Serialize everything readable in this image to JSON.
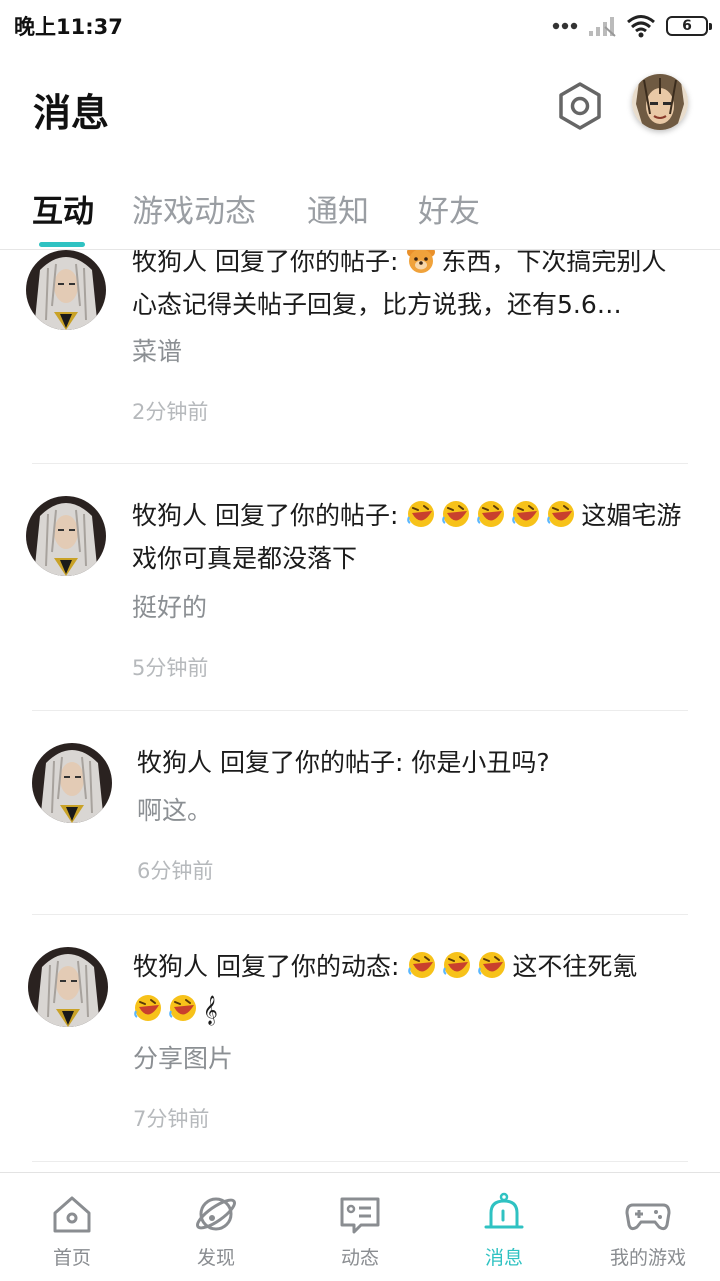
{
  "status_bar": {
    "time": "晚上11:37",
    "battery": "6"
  },
  "header": {
    "title": "消息"
  },
  "tabs": [
    {
      "label": "互动",
      "active": true
    },
    {
      "label": "游戏动态",
      "active": false
    },
    {
      "label": "通知",
      "active": false
    },
    {
      "label": "好友",
      "active": false
    }
  ],
  "messages": [
    {
      "user": "牧狗人",
      "action": "回复了你的帖子:",
      "emojis": [
        "bear-emoji"
      ],
      "text": "东西，下次搞完别人心态记得关帖子回复，比方说我，还有5.6…",
      "sub": "菜谱",
      "time": "2分钟前"
    },
    {
      "user": "牧狗人",
      "action": "回复了你的帖子:",
      "emojis": [
        "laughing-emoji",
        "laughing-emoji",
        "laughing-emoji",
        "laughing-emoji",
        "laughing-emoji"
      ],
      "text": "这媚宅游戏你可真是都没落下",
      "sub": "挺好的",
      "time": "5分钟前"
    },
    {
      "user": "牧狗人",
      "action": "回复了你的帖子:",
      "emojis": [],
      "text": "你是小丑吗?",
      "sub": "啊这。",
      "time": "6分钟前"
    },
    {
      "user": "牧狗人",
      "action": "回复了你的动态:",
      "emojis": [
        "laughing-emoji",
        "laughing-emoji",
        "laughing-emoji"
      ],
      "text": "这不往死氪",
      "trailing_emojis": [
        "laughing-emoji",
        "laughing-emoji"
      ],
      "trailing_text": "𝄞",
      "sub": "分享图片",
      "time": "7分钟前"
    }
  ],
  "bottom_nav": [
    {
      "label": "首页",
      "icon": "home-icon",
      "active": false
    },
    {
      "label": "发现",
      "icon": "planet-icon",
      "active": false
    },
    {
      "label": "动态",
      "icon": "feed-icon",
      "active": false
    },
    {
      "label": "消息",
      "icon": "bell-icon",
      "active": true
    },
    {
      "label": "我的游戏",
      "icon": "gamepad-icon",
      "active": false
    }
  ],
  "colors": {
    "accent": "#2fc2c2",
    "muted": "#8b8f93",
    "time": "#b6b9bc"
  }
}
